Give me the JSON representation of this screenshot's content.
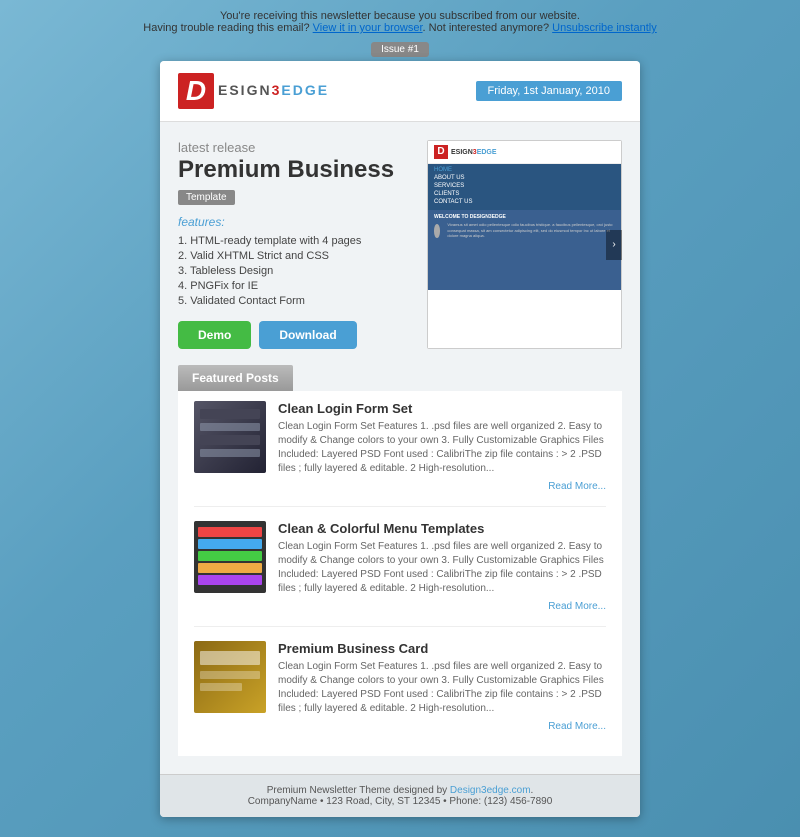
{
  "topbar": {
    "notice": "You're receiving this newsletter because you subscribed from our website.",
    "trouble": "Having trouble reading this email?",
    "view_link": "View it in your browser",
    "not_interested": "Not interested anymore?",
    "unsubscribe_link": "Unsubscribe instantly"
  },
  "issue": {
    "badge": "Issue #1"
  },
  "header": {
    "logo_d": "D",
    "logo_text": "ESIGN",
    "logo_three": "3",
    "logo_edge": "EDGE",
    "date": "Friday, 1st January, 2010"
  },
  "release": {
    "label": "latest release",
    "title": "Premium Business",
    "template_badge": "Template",
    "features_label": "features:",
    "features": [
      "1. HTML-ready template with 4 pages",
      "2. Valid XHTML Strict and CSS",
      "3. Tableless Design",
      "4. PNGFix for IE",
      "5. Validated Contact Form"
    ],
    "btn_demo": "Demo",
    "btn_download": "Download"
  },
  "mockup": {
    "logo_d": "D",
    "logo_text": "ESIGN3EDGE",
    "nav_items": [
      "HOME",
      "ABOUT US",
      "SERVICES",
      "CLIENTS",
      "CONTACT US"
    ],
    "welcome_title": "WELCOME TO DESIGN3EDGE",
    "body_text": "Vivamus sit amet odio pellentesque odio faucibus tristique. a faucibus pellentesque, orci justo consequat massa, sit amet, consectetur adipiscing elit, sed do eiusmod tempor incididunt ut labore et dolore magna aliqua.",
    "arrow": "›"
  },
  "featured": {
    "header": "Featured Posts",
    "posts": [
      {
        "title": "Clean Login Form Set",
        "desc": "Clean Login Form Set Features 1. .psd files are well organized 2. Easy to modify & Change colors to your own 3. Fully Customizable Graphics Files Included: Layered PSD Font used : CalibriThe zip file contains : > 2 .PSD files ; fully layered & editable. 2 High-resolution...",
        "read_more": "Read More..."
      },
      {
        "title": "Clean & Colorful Menu Templates",
        "desc": "Clean Login Form Set Features 1. .psd files are well organized 2. Easy to modify & Change colors to your own 3. Fully Customizable Graphics Files Included: Layered PSD Font used : CalibriThe zip file contains : > 2 .PSD files ; fully layered & editable. 2 High-resolution...",
        "read_more": "Read More..."
      },
      {
        "title": "Premium Business Card",
        "desc": "Clean Login Form Set Features 1. .psd files are well organized 2. Easy to modify & Change colors to your own 3. Fully Customizable Graphics Files Included: Layered PSD Font used : CalibriThe zip file contains : > 2 .PSD files ; fully layered & editable. 2 High-resolution...",
        "read_more": "Read More..."
      }
    ]
  },
  "footer": {
    "line1": "Premium Newsletter Theme designed by",
    "design_link": "Design3edge.com",
    "line2": "CompanyName • 123 Road, City, ST 12345 • Phone: (123) 456-7890"
  }
}
